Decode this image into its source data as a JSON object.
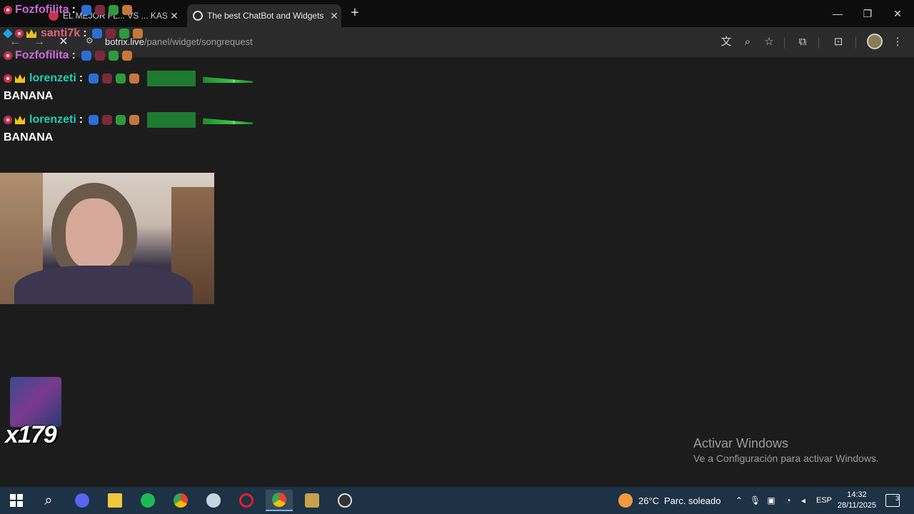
{
  "browser": {
    "tabs": [
      {
        "title": "EL MEJOR FL... VS ... KAS F",
        "active": false
      },
      {
        "title": "The best ChatBot and Widgets",
        "active": true
      }
    ],
    "address": {
      "domain": "botrix.live",
      "path": "/panel/widget/songrequest"
    }
  },
  "chat": {
    "messages": [
      {
        "user": "Fozfofilita",
        "color": "#c96bd6",
        "text": ""
      },
      {
        "user": "santi7k",
        "color": "#e0607e",
        "text": ""
      },
      {
        "user": "Fozfofilita",
        "color": "#c96bd6",
        "text": ""
      },
      {
        "user": "lorenzeti",
        "color": "#1fd1b0",
        "text": "BANANA"
      },
      {
        "user": "lorenzeti",
        "color": "#1fd1b0",
        "text": "BANANA"
      }
    ],
    "emote_colors": [
      "#2b6fd6",
      "#7a2a3a",
      "#2f9a3c",
      "#c8773a"
    ]
  },
  "overlay": {
    "sub_count": "x179"
  },
  "watermark": {
    "title": "Activar Windows",
    "subtitle": "Ve a Configuración para activar Windows."
  },
  "taskbar": {
    "weather_temp": "26°C",
    "weather_desc": "Parc. soleado",
    "language": "ESP",
    "time": "14:32",
    "date": "28/11/2025",
    "notifications": "3",
    "app_icons": [
      "start-icon",
      "search-icon",
      "discord-icon",
      "file-explorer-icon",
      "spotify-icon",
      "chrome-icon",
      "steam-icon",
      "opera-icon",
      "chrome-active-icon",
      "league-icon",
      "obs-icon"
    ]
  }
}
